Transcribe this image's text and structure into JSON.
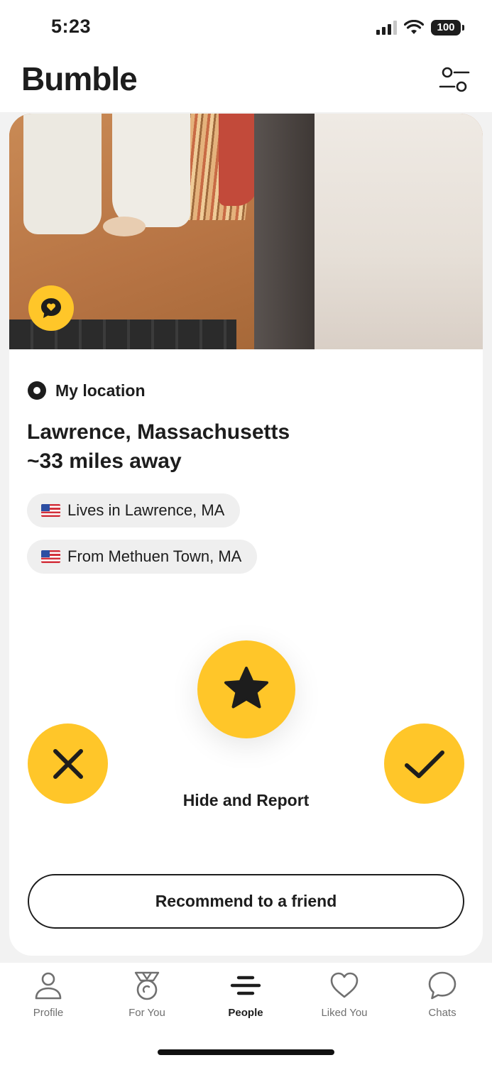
{
  "status_bar": {
    "time": "5:23",
    "battery": "100"
  },
  "header": {
    "brand": "Bumble",
    "filter_icon": "filter-sliders-icon"
  },
  "card": {
    "photo_badge_icon": "chat-heart-icon",
    "location_label": "My location",
    "place_line1": "Lawrence, Massachusetts",
    "place_line2": "~33 miles away",
    "chips": [
      {
        "icon": "us-flag-icon",
        "text": "Lives in Lawrence, MA"
      },
      {
        "icon": "us-flag-icon",
        "text": "From Methuen Town, MA"
      }
    ],
    "actions": {
      "superswipe_icon": "star-icon",
      "pass_icon": "close-icon",
      "like_icon": "check-icon",
      "hide_report": "Hide and Report",
      "recommend": "Recommend to a friend"
    }
  },
  "colors": {
    "accent": "#ffc629",
    "text": "#1d1d1d"
  },
  "tabs": [
    {
      "label": "Profile",
      "icon": "person-icon",
      "active": false
    },
    {
      "label": "For You",
      "icon": "medal-icon",
      "active": false
    },
    {
      "label": "People",
      "icon": "bumble-stripes-icon",
      "active": true
    },
    {
      "label": "Liked You",
      "icon": "heart-icon",
      "active": false
    },
    {
      "label": "Chats",
      "icon": "chat-bubble-icon",
      "active": false
    }
  ]
}
